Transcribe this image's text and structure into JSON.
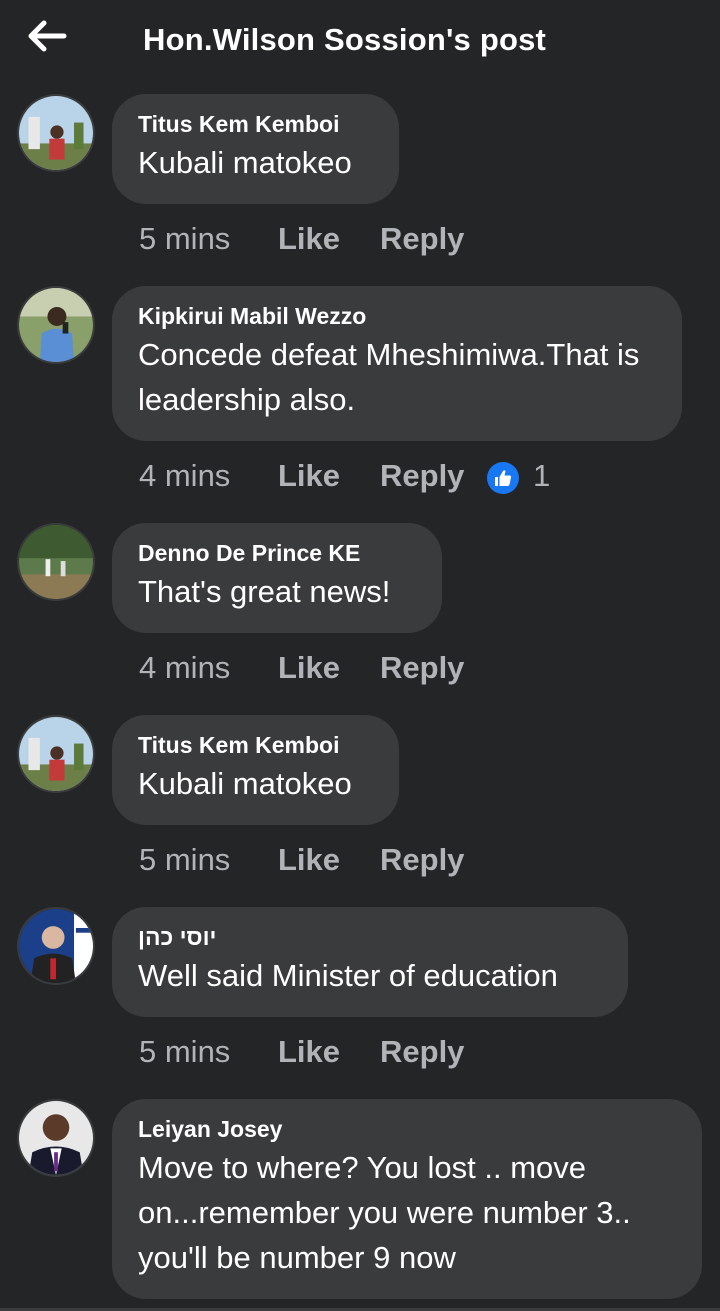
{
  "header": {
    "title": "Hon.Wilson Sossion's post",
    "back_icon": "arrow-left-icon"
  },
  "colors": {
    "background": "#242526",
    "bubble": "#3a3b3c",
    "text_primary": "#ffffff",
    "text_secondary": "#b0b3b8",
    "like_blue": "#1877f2"
  },
  "comments": [
    {
      "author": "Titus Kem Kemboi",
      "text": "Kubali matokeo",
      "time": "5 mins",
      "like": "Like",
      "reply": "Reply"
    },
    {
      "author": "Kipkirui Mabil Wezzo",
      "text": "Concede defeat Mheshimiwa.That is leadership also.",
      "time": "4 mins",
      "like": "Like",
      "reply": "Reply",
      "reaction_icon": "like-reaction-icon",
      "reaction_count": "1"
    },
    {
      "author": "Denno De Prince KE",
      "text": "That's great news!",
      "time": "4 mins",
      "like": "Like",
      "reply": "Reply"
    },
    {
      "author": "Titus Kem Kemboi",
      "text": "Kubali matokeo",
      "time": "5 mins",
      "like": "Like",
      "reply": "Reply"
    },
    {
      "author": "יוסי כהן",
      "text": "Well said Minister of education",
      "time": "5 mins",
      "like": "Like",
      "reply": "Reply"
    },
    {
      "author": "Leiyan Josey",
      "text": "Move to where? You lost .. move on...remember you were number 3.. you'll be number 9 now"
    }
  ]
}
